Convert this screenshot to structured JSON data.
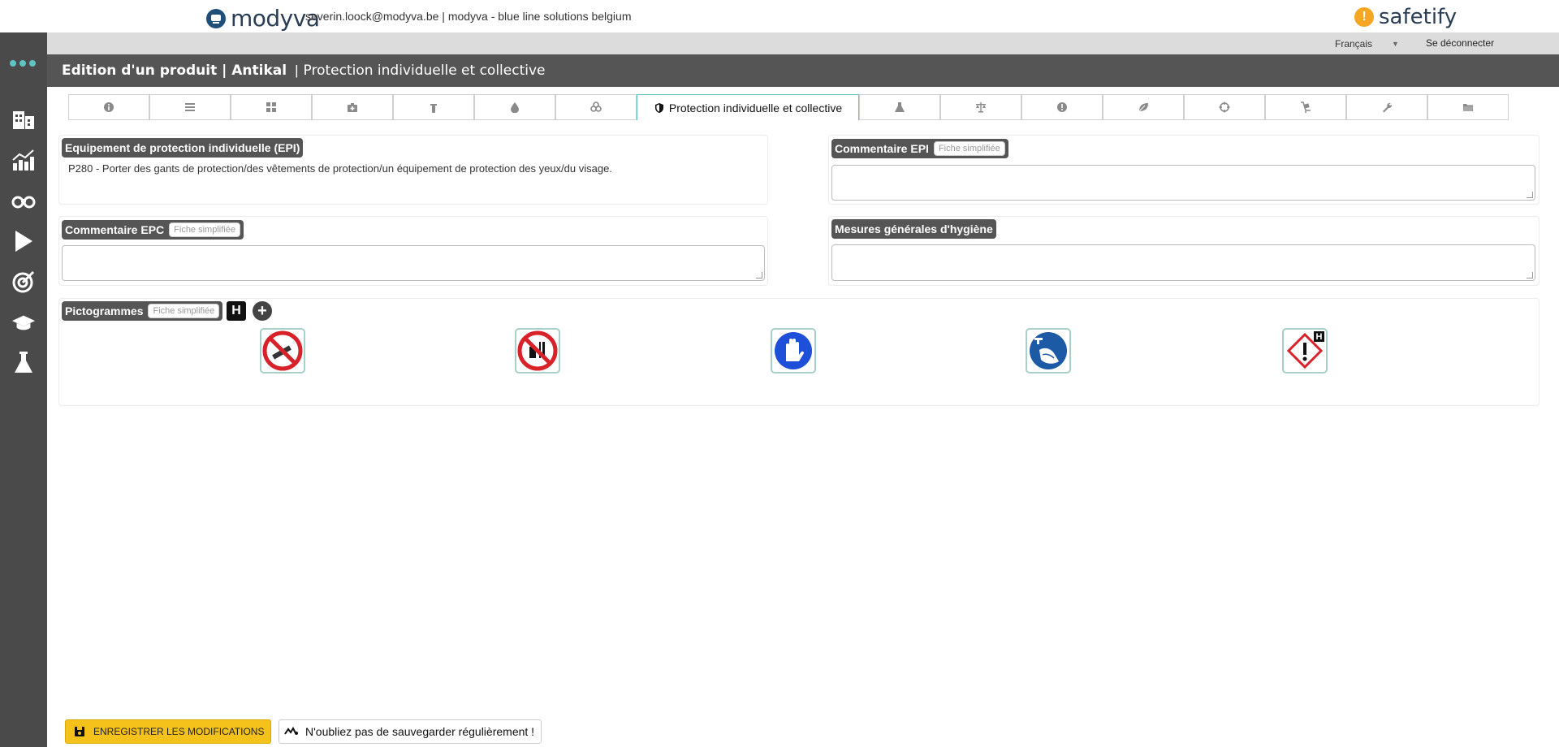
{
  "header": {
    "brand": "modyva",
    "user_info": "severin.loock@modyva.be | modyva - blue line solutions belgium",
    "partner_brand": "safetify"
  },
  "subbar": {
    "language": "Français",
    "logout": "Se déconnecter"
  },
  "titlebar": {
    "title": "Edition d'un produit | Antikal",
    "separator": "|",
    "subtitle": "Protection individuelle et collective"
  },
  "tabs": {
    "active_label": "Protection individuelle et collective",
    "icons": [
      "info-icon",
      "list-icon",
      "grid-icon",
      "first-aid-icon",
      "fire-extinguisher-icon",
      "drop-icon",
      "biohazard-icon",
      "shield-icon",
      "flask-icon",
      "balance-icon",
      "alert-icon",
      "leaf-icon",
      "crosshair-icon",
      "trolley-icon",
      "wrench-icon",
      "folder-icon"
    ]
  },
  "sections": {
    "epi": {
      "label": "Equipement de protection individuelle (EPI)",
      "text": "P280 - Porter des gants de protection/des vêtements de protection/un équipement de protection des yeux/du visage."
    },
    "commentaire_epi": {
      "label": "Commentaire EPI",
      "pill": "Fiche simplifiée"
    },
    "commentaire_epc": {
      "label": "Commentaire EPC",
      "pill": "Fiche simplifiée"
    },
    "hygiene": {
      "label": "Mesures générales d'hygiène"
    },
    "pictogrammes": {
      "label": "Pictogrammes",
      "pill": "Fiche simplifiée",
      "h_button": "H",
      "add_button": "+"
    }
  },
  "pictograms": [
    {
      "name": "no-smoking-icon"
    },
    {
      "name": "no-eating-drinking-icon"
    },
    {
      "name": "wear-gloves-icon"
    },
    {
      "name": "wash-hands-icon"
    },
    {
      "name": "ghs-exclamation-icon",
      "badge": "H"
    }
  ],
  "footer": {
    "save_label": "ENREGISTRER LES MODIFICATIONS",
    "reminder": "N'oubliez pas de sauvegarder régulièrement !"
  },
  "colors": {
    "accent": "#5ec4c4",
    "sidebar": "#4a4a4a",
    "titlebar": "#555555",
    "save": "#f4c21b"
  }
}
